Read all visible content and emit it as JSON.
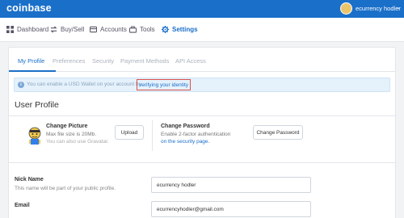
{
  "topbar": {
    "logo": "coinbase",
    "user_name": "ecurrency hodler",
    "caret": "⌄"
  },
  "nav": {
    "items": [
      {
        "label": "Dashboard",
        "icon": "dashboard-icon"
      },
      {
        "label": "Buy/Sell",
        "icon": "buy-sell-icon"
      },
      {
        "label": "Accounts",
        "icon": "accounts-icon"
      },
      {
        "label": "Tools",
        "icon": "tools-icon"
      },
      {
        "label": "Settings",
        "icon": "gear-icon",
        "active": true
      }
    ]
  },
  "subtabs": [
    "My Profile",
    "Preferences",
    "Security",
    "Payment Methods",
    "API Access"
  ],
  "notice": {
    "icon": "info-icon",
    "text": "You can enable a USD Wallet on your account by",
    "link": "verifying your identity"
  },
  "profile": {
    "title": "User Profile",
    "change_picture": {
      "label": "Change Picture",
      "sub1": "Max file size is 20Mb.",
      "sub2": "You can also use Gravatar.",
      "button": "Upload"
    },
    "change_password": {
      "label": "Change Password",
      "sub1": "Enable 2-factor authentication",
      "link": "on the security page.",
      "button": "Change Password"
    },
    "nick_name": {
      "label": "Nick Name",
      "sub": "This name will be part of your public profile.",
      "value": "ecurrency hodler"
    },
    "email": {
      "label": "Email",
      "value": "ecurrencyhodler@gmail.com"
    }
  },
  "colors": {
    "brand_blue": "#1a6fc9",
    "highlight_red": "#d9534f",
    "notice_bg": "#e5f1fb"
  }
}
